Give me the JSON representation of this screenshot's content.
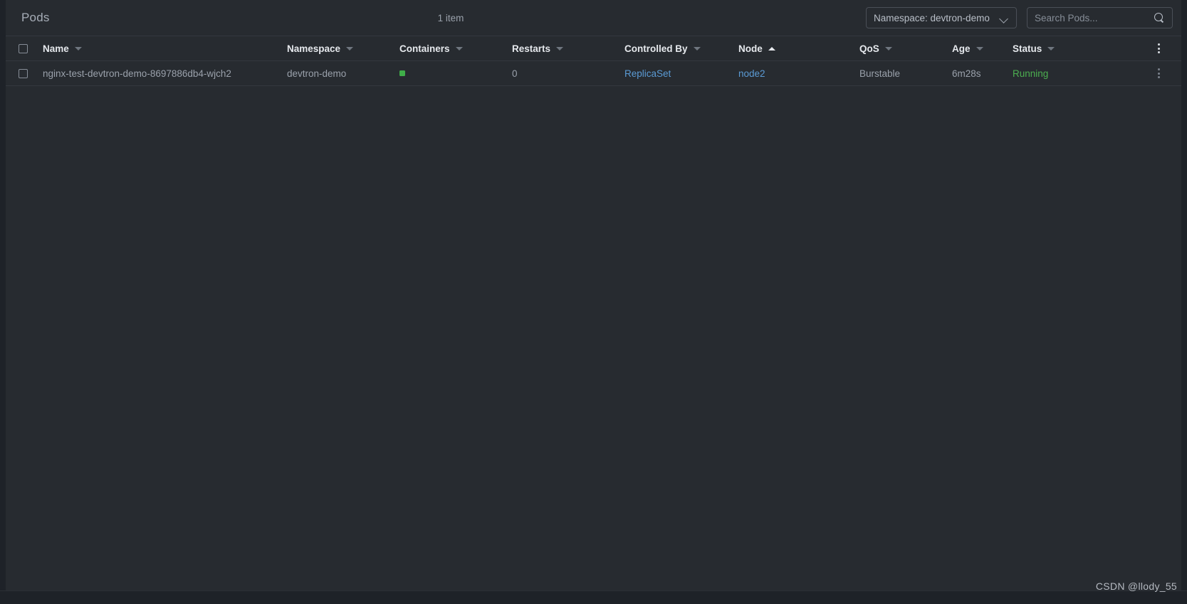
{
  "header": {
    "title": "Pods",
    "item_count": "1 item",
    "namespace_selector": {
      "label": "Namespace: devtron-demo",
      "icon": "chevron-down-icon"
    },
    "search": {
      "placeholder": "Search Pods...",
      "value": "",
      "icon": "search-icon"
    }
  },
  "table": {
    "columns": [
      {
        "key": "name",
        "label": "Name",
        "sort": "desc"
      },
      {
        "key": "namespace",
        "label": "Namespace",
        "sort": "desc"
      },
      {
        "key": "containers",
        "label": "Containers",
        "sort": "desc"
      },
      {
        "key": "restarts",
        "label": "Restarts",
        "sort": "desc"
      },
      {
        "key": "controlled_by",
        "label": "Controlled By",
        "sort": "desc"
      },
      {
        "key": "node",
        "label": "Node",
        "sort": "asc"
      },
      {
        "key": "qos",
        "label": "QoS",
        "sort": "desc"
      },
      {
        "key": "age",
        "label": "Age",
        "sort": "desc"
      },
      {
        "key": "status",
        "label": "Status",
        "sort": "desc"
      }
    ],
    "rows": [
      {
        "name": "nginx-test-devtron-demo-8697886db4-wjch2",
        "namespace": "devtron-demo",
        "containers_ready": 1,
        "restarts": "0",
        "controlled_by": "ReplicaSet",
        "node": "node2",
        "qos": "Burstable",
        "age": "6m28s",
        "status": "Running"
      }
    ]
  },
  "watermark": "CSDN @llody_55",
  "colors": {
    "page_background": "#1e2228",
    "panel_background": "#272b30",
    "row_divider": "#33383e",
    "text_primary": "#e6e9ed",
    "text_muted": "#9aa1ab",
    "link": "#5b9bd5",
    "status_running": "#4caf50",
    "container_ready": "#3fae49",
    "border": "#4a4f57"
  }
}
